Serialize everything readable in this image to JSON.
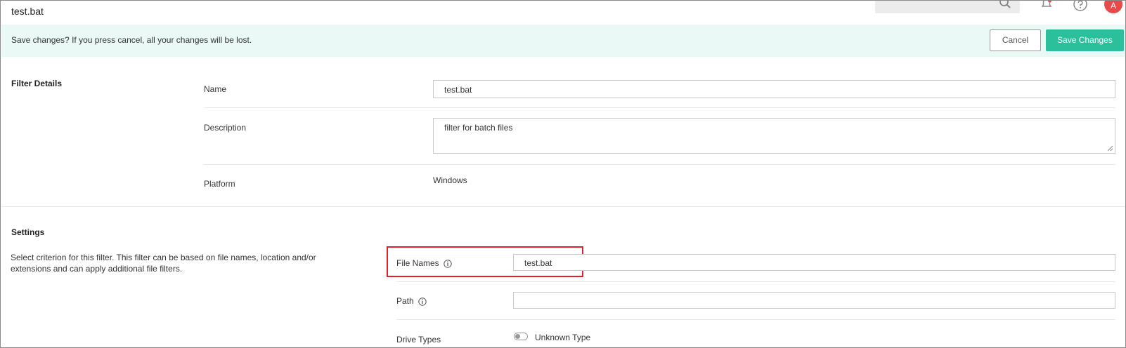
{
  "header": {
    "title": "test.bat",
    "avatar_initial": "A"
  },
  "banner": {
    "message": "Save changes? If you press cancel, all your changes will be lost.",
    "cancel_label": "Cancel",
    "save_label": "Save Changes"
  },
  "filter_details": {
    "section_title": "Filter Details",
    "name_label": "Name",
    "name_value": "test.bat",
    "description_label": "Description",
    "description_value": "filter for batch files",
    "platform_label": "Platform",
    "platform_value": "Windows"
  },
  "settings": {
    "section_title": "Settings",
    "description": "Select criterion for this filter. This filter can be based on file names, location and/or extensions and can apply additional file filters.",
    "file_names_label": "File Names",
    "file_names_value": "test.bat",
    "path_label": "Path",
    "path_value": "",
    "drive_types_label": "Drive Types",
    "unknown_type_label": "Unknown Type",
    "unknown_type_enabled": false
  },
  "colors": {
    "accent": "#2bbf9c",
    "banner_bg": "#eaf9f6",
    "highlight": "#e0202a",
    "avatar": "#e84a4a"
  }
}
